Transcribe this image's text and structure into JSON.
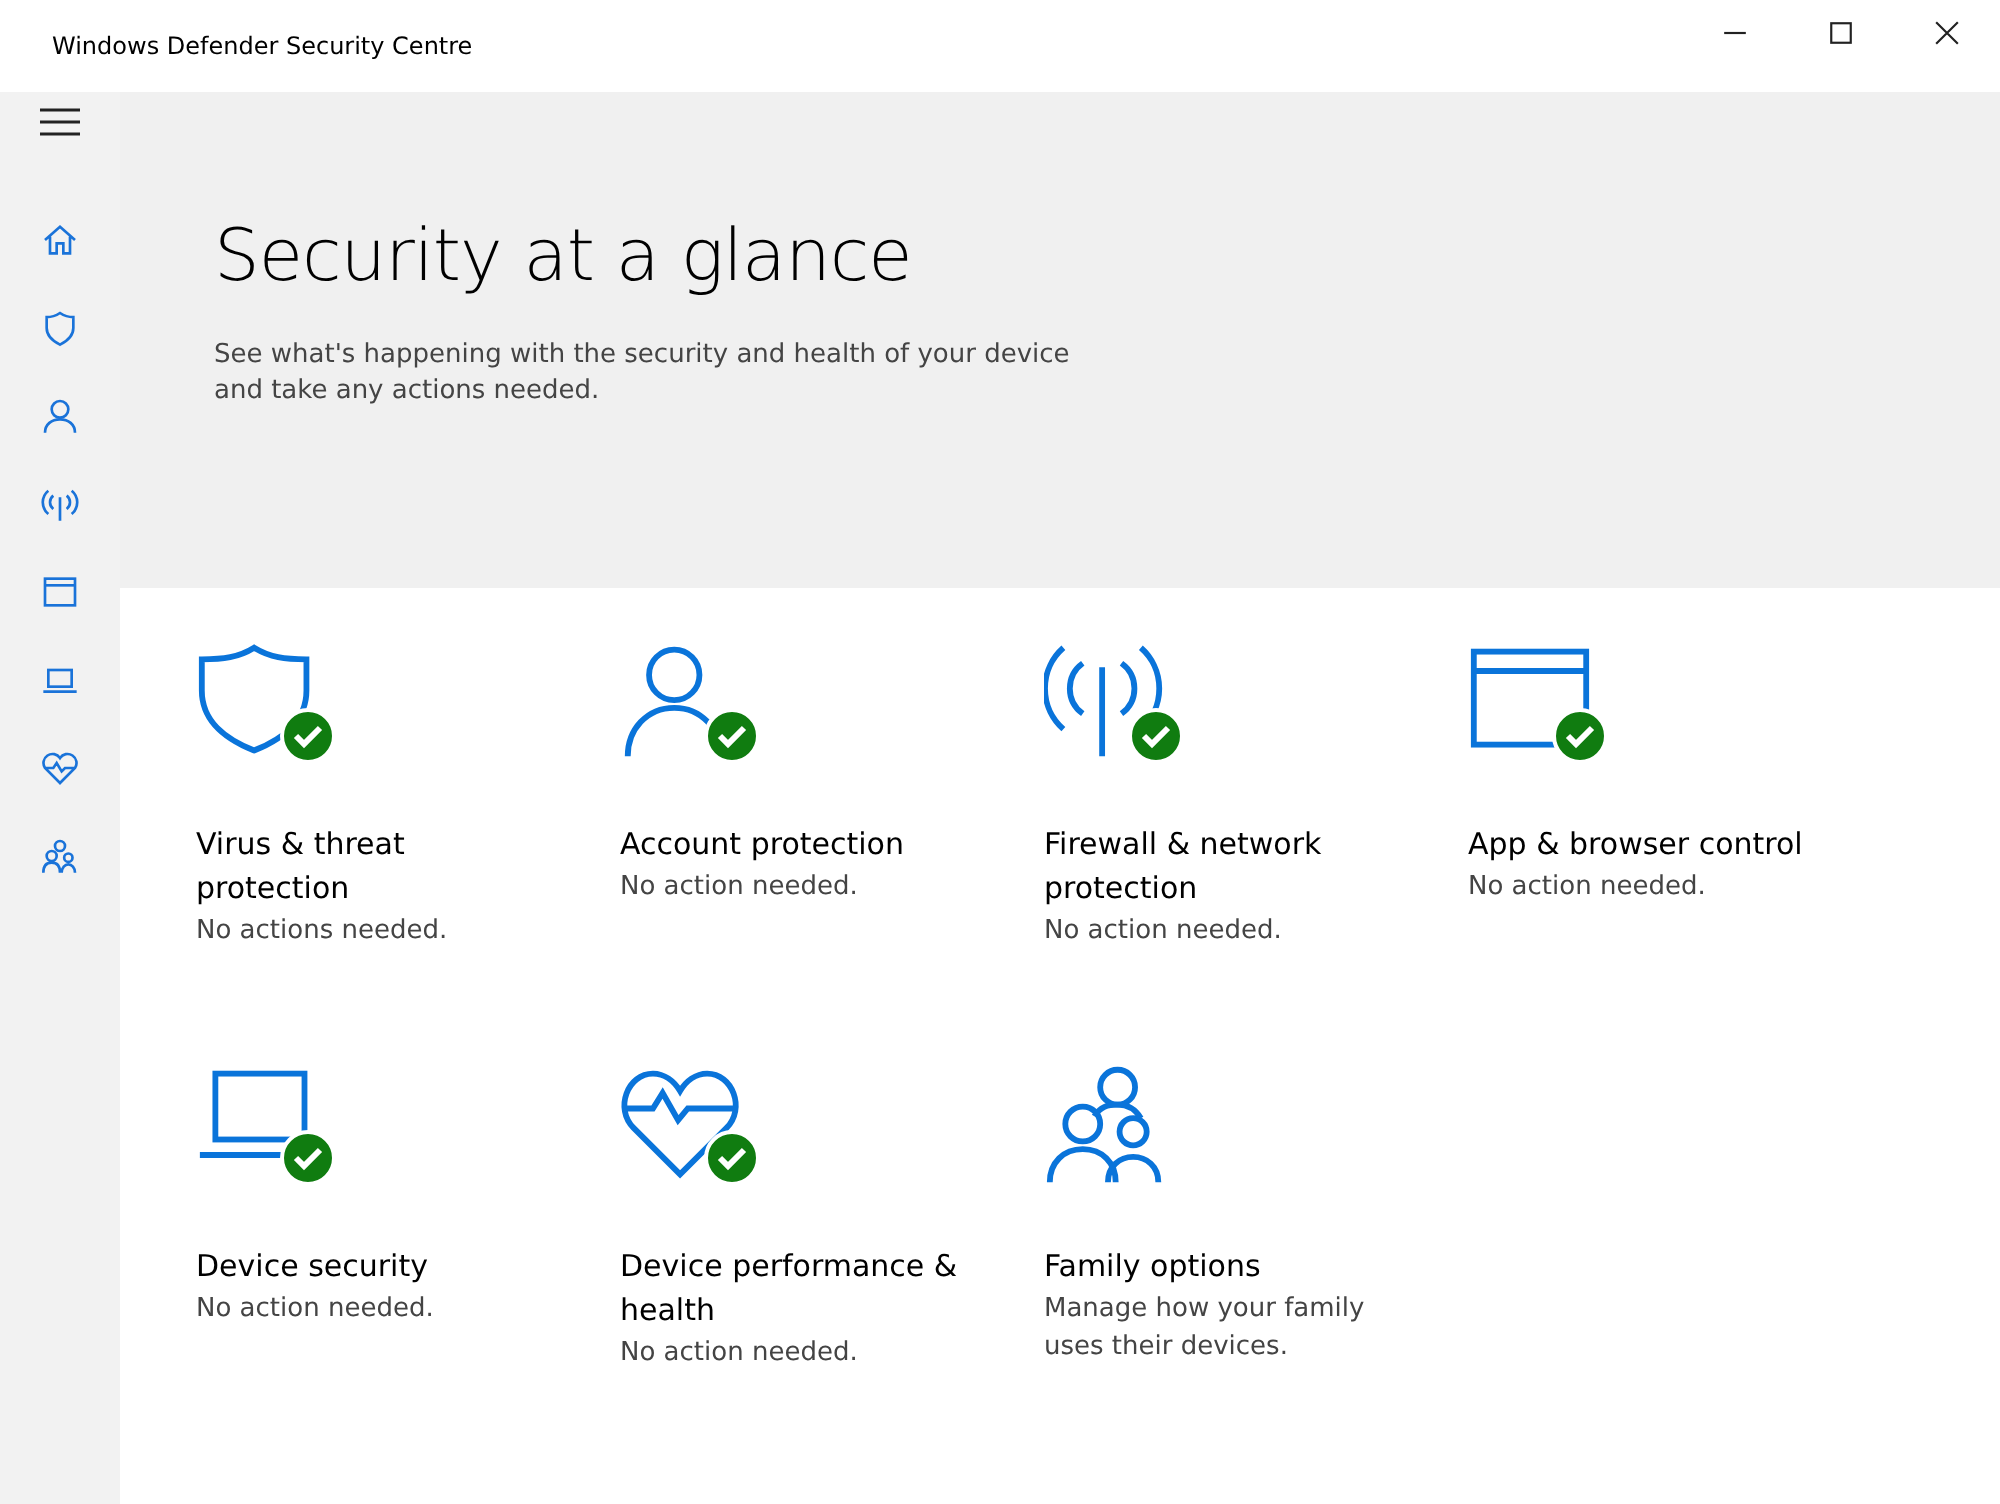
{
  "window": {
    "title": "Windows Defender Security Centre"
  },
  "sidebar": {
    "items": [
      {
        "kind": "home",
        "selected": false
      },
      {
        "kind": "shield",
        "selected": false
      },
      {
        "kind": "person",
        "selected": false
      },
      {
        "kind": "antenna",
        "selected": false
      },
      {
        "kind": "window",
        "selected": false
      },
      {
        "kind": "laptop",
        "selected": false
      },
      {
        "kind": "heart",
        "selected": false
      },
      {
        "kind": "family",
        "selected": false
      }
    ]
  },
  "header": {
    "title": "Security at a glance",
    "description": "See what's happening with the security and health of your device and take any actions needed."
  },
  "tiles": [
    {
      "kind": "shield",
      "ok": true,
      "title": "Virus & threat protection",
      "status": "No actions needed."
    },
    {
      "kind": "person",
      "ok": true,
      "title": "Account protection",
      "status": "No action needed."
    },
    {
      "kind": "antenna",
      "ok": true,
      "title": "Firewall & network protection",
      "status": "No action needed."
    },
    {
      "kind": "window",
      "ok": true,
      "title": "App & browser control",
      "status": "No action needed."
    },
    {
      "kind": "laptop",
      "ok": true,
      "title": "Device security",
      "status": "No action needed."
    },
    {
      "kind": "heart",
      "ok": true,
      "title": "Device performance & health",
      "status": "No action needed."
    },
    {
      "kind": "family",
      "ok": false,
      "title": "Family options",
      "status": "Manage how your family uses their devices."
    }
  ]
}
